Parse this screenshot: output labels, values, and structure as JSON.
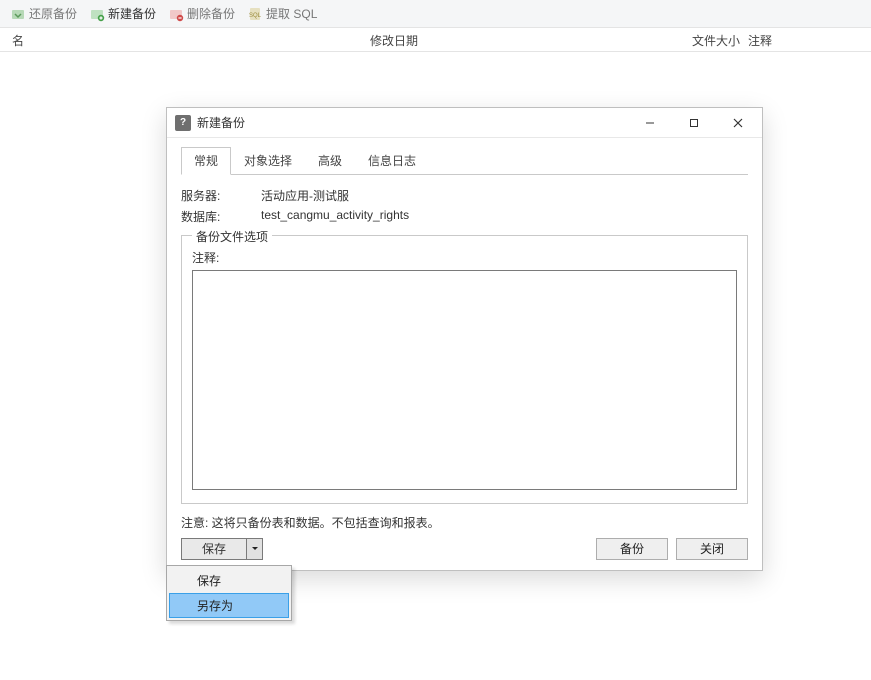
{
  "toolbar": {
    "restore": "还原备份",
    "new": "新建备份",
    "delete": "删除备份",
    "extract": "提取 SQL"
  },
  "list_header": {
    "name": "名",
    "date": "修改日期",
    "size": "文件大小",
    "note": "注释"
  },
  "dialog": {
    "title": "新建备份",
    "tabs": {
      "general": "常规",
      "objects": "对象选择",
      "advanced": "高级",
      "log": "信息日志"
    },
    "server_label": "服务器:",
    "server_value": "活动应用-测试服",
    "database_label": "数据库:",
    "database_value": "test_cangmu_activity_rights",
    "fieldset_title": "备份文件选项",
    "comment_label": "注释:",
    "comment_value": "",
    "note": "注意: 这将只备份表和数据。不包括查询和报表。",
    "save_btn": "保存",
    "backup_btn": "备份",
    "close_btn": "关闭"
  },
  "dropdown": {
    "save": "保存",
    "save_as": "另存为"
  }
}
